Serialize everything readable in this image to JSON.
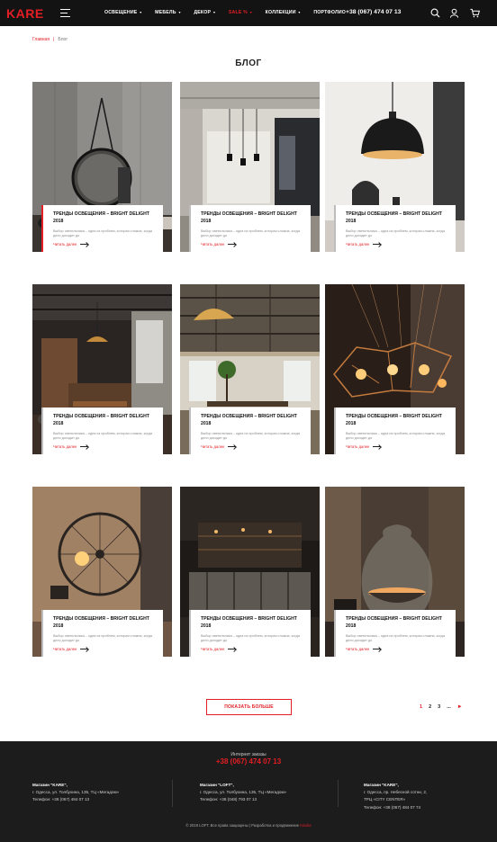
{
  "header": {
    "logo": "KARE",
    "nav": [
      {
        "label": "ОСВЕЩЕНИЕ",
        "caret": true,
        "active": false
      },
      {
        "label": "МЕБЕЛЬ",
        "caret": true,
        "active": false
      },
      {
        "label": "ДЕКОР",
        "caret": true,
        "active": false
      },
      {
        "label": "SALE %",
        "caret": true,
        "active": true
      },
      {
        "label": "КОЛЛЕКЦИИ",
        "caret": true,
        "active": false
      },
      {
        "label": "ПОРТФОЛИО",
        "caret": false,
        "active": false
      }
    ],
    "phone": "+38 (067) 474 07 13",
    "icons": [
      "search-icon",
      "user-icon",
      "cart-icon"
    ]
  },
  "breadcrumb": {
    "home": "Главная",
    "separator": "|",
    "current": "Блог"
  },
  "page_title": "БЛОГ",
  "cards": [
    {
      "title": "ТРЕНДЫ ОСВЕЩЕНИЯ – BRIGHT DELIGHT 2018",
      "text": "Выбор светильника – одна из проблем, которая сложна, когда дело доходит до",
      "link": "Читать далее",
      "scene": "mirror"
    },
    {
      "title": "ТРЕНДЫ ОСВЕЩЕНИЯ – BRIGHT DELIGHT 2018",
      "text": "Выбор светильника – одна из проблем, которая сложна, когда дело доходит до",
      "link": "Читать далее",
      "scene": "dining"
    },
    {
      "title": "ТРЕНДЫ ОСВЕЩЕНИЯ – BRIGHT DELIGHT 2018",
      "text": "Выбор светильника – одна из проблем, которая сложна, когда дело доходит до",
      "link": "Читать далее",
      "scene": "pendant"
    },
    {
      "title": "ТРЕНДЫ ОСВЕЩЕНИЯ – BRIGHT DELIGHT 2018",
      "text": "Выбор светильника – одна из проблем, которая сложна, когда дело доходит до",
      "link": "Читать далее",
      "scene": "restaurant"
    },
    {
      "title": "ТРЕНДЫ ОСВЕЩЕНИЯ – BRIGHT DELIGHT 2018",
      "text": "Выбор светильника – одна из проблем, которая сложна, когда дело доходит до",
      "link": "Читать далее",
      "scene": "loft"
    },
    {
      "title": "ТРЕНДЫ ОСВЕЩЕНИЯ – BRIGHT DELIGHT 2018",
      "text": "Выбор светильника – одна из проблем, которая сложна, когда дело доходит до",
      "link": "Читать далее",
      "scene": "chandelier"
    },
    {
      "title": "ТРЕНДЫ ОСВЕЩЕНИЯ – BRIGHT DELIGHT 2018",
      "text": "Выбор светильника – одна из проблем, которая сложна, когда дело доходит до",
      "link": "Читать далее",
      "scene": "wheel"
    },
    {
      "title": "ТРЕНДЫ ОСВЕЩЕНИЯ – BRIGHT DELIGHT 2018",
      "text": "Выбор светильника – одна из проблем, которая сложна, когда дело доходит до",
      "link": "Читать далее",
      "scene": "bar"
    },
    {
      "title": "ТРЕНДЫ ОСВЕЩЕНИЯ – BRIGHT DELIGHT 2018",
      "text": "Выбор светильника – одна из проблем, которая сложна, когда дело доходит до",
      "link": "Читать далее",
      "scene": "glass-lamp"
    }
  ],
  "more_button": "ПОКАЗАТЬ БОЛЬШЕ",
  "pagination": {
    "pages": [
      "1",
      "2",
      "3"
    ],
    "ellipsis": "...",
    "current": "1",
    "next": "►"
  },
  "footer": {
    "label": "Интернет заказы",
    "phone": "+38 (067) 474 07 13",
    "stores": [
      {
        "name": "Магазин \"KARE\",",
        "lines": [
          "г. Одесса, ул. Толбухина, 135, ТЦ «Мегадом»",
          "Телефон: +38 (067) 484 07 13"
        ]
      },
      {
        "name": "Магазин \"LOFT\",",
        "lines": [
          "г. Одесса, ул. Толбухина, 135, ТЦ «Мегадом»",
          "Телефон: +38 (048) 793 07 13"
        ]
      },
      {
        "name": "Магазин \"KARE\",",
        "lines": [
          "г. Одесса, пр. Небесной сотни, 2,",
          "ТРЦ «CITY CENTER»",
          "Телефон: +38 (067) 484 07 74"
        ]
      }
    ],
    "copyright": "© 2019 LOFT. Все права защищены | Разработка и продвижение",
    "developer": "Kisulia"
  },
  "colors": {
    "accent": "#e31e24",
    "header_bg": "#131313",
    "footer_bg": "#1c1c1c"
  }
}
